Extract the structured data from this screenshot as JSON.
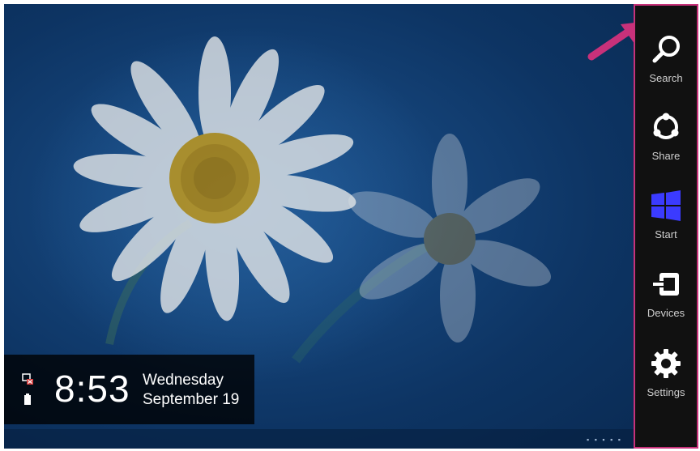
{
  "lock_screen": {
    "time": "8:53",
    "day": "Wednesday",
    "date": "September 19"
  },
  "charms": {
    "search": "Search",
    "share": "Share",
    "start": "Start",
    "devices": "Devices",
    "settings": "Settings"
  },
  "colors": {
    "accent": "#c8317a",
    "start_logo": "#3b3bff",
    "background": "#124075"
  }
}
